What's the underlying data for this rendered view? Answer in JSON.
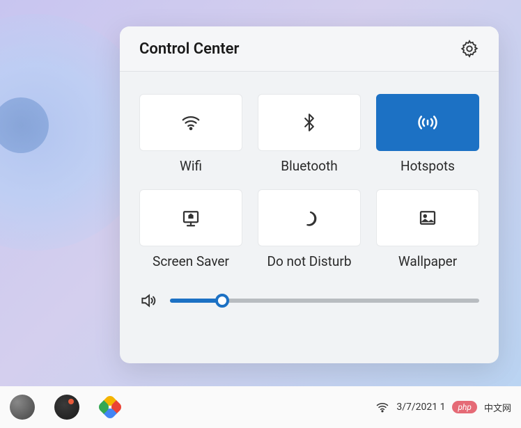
{
  "panel": {
    "title": "Control Center",
    "tiles": [
      {
        "label": "Wifi",
        "active": false,
        "icon": "wifi-icon"
      },
      {
        "label": "Bluetooth",
        "active": false,
        "icon": "bluetooth-icon"
      },
      {
        "label": "Hotspots",
        "active": true,
        "icon": "hotspot-icon"
      },
      {
        "label": "Screen Saver",
        "active": false,
        "icon": "screensaver-icon"
      },
      {
        "label": "Do not Disturb",
        "active": false,
        "icon": "dnd-icon"
      },
      {
        "label": "Wallpaper",
        "active": false,
        "icon": "wallpaper-icon"
      }
    ],
    "volume_percent": 17
  },
  "taskbar": {
    "datetime": "3/7/2021 1",
    "badge": "php",
    "text_cn": "中文网"
  },
  "colors": {
    "accent": "#1c71c4"
  }
}
